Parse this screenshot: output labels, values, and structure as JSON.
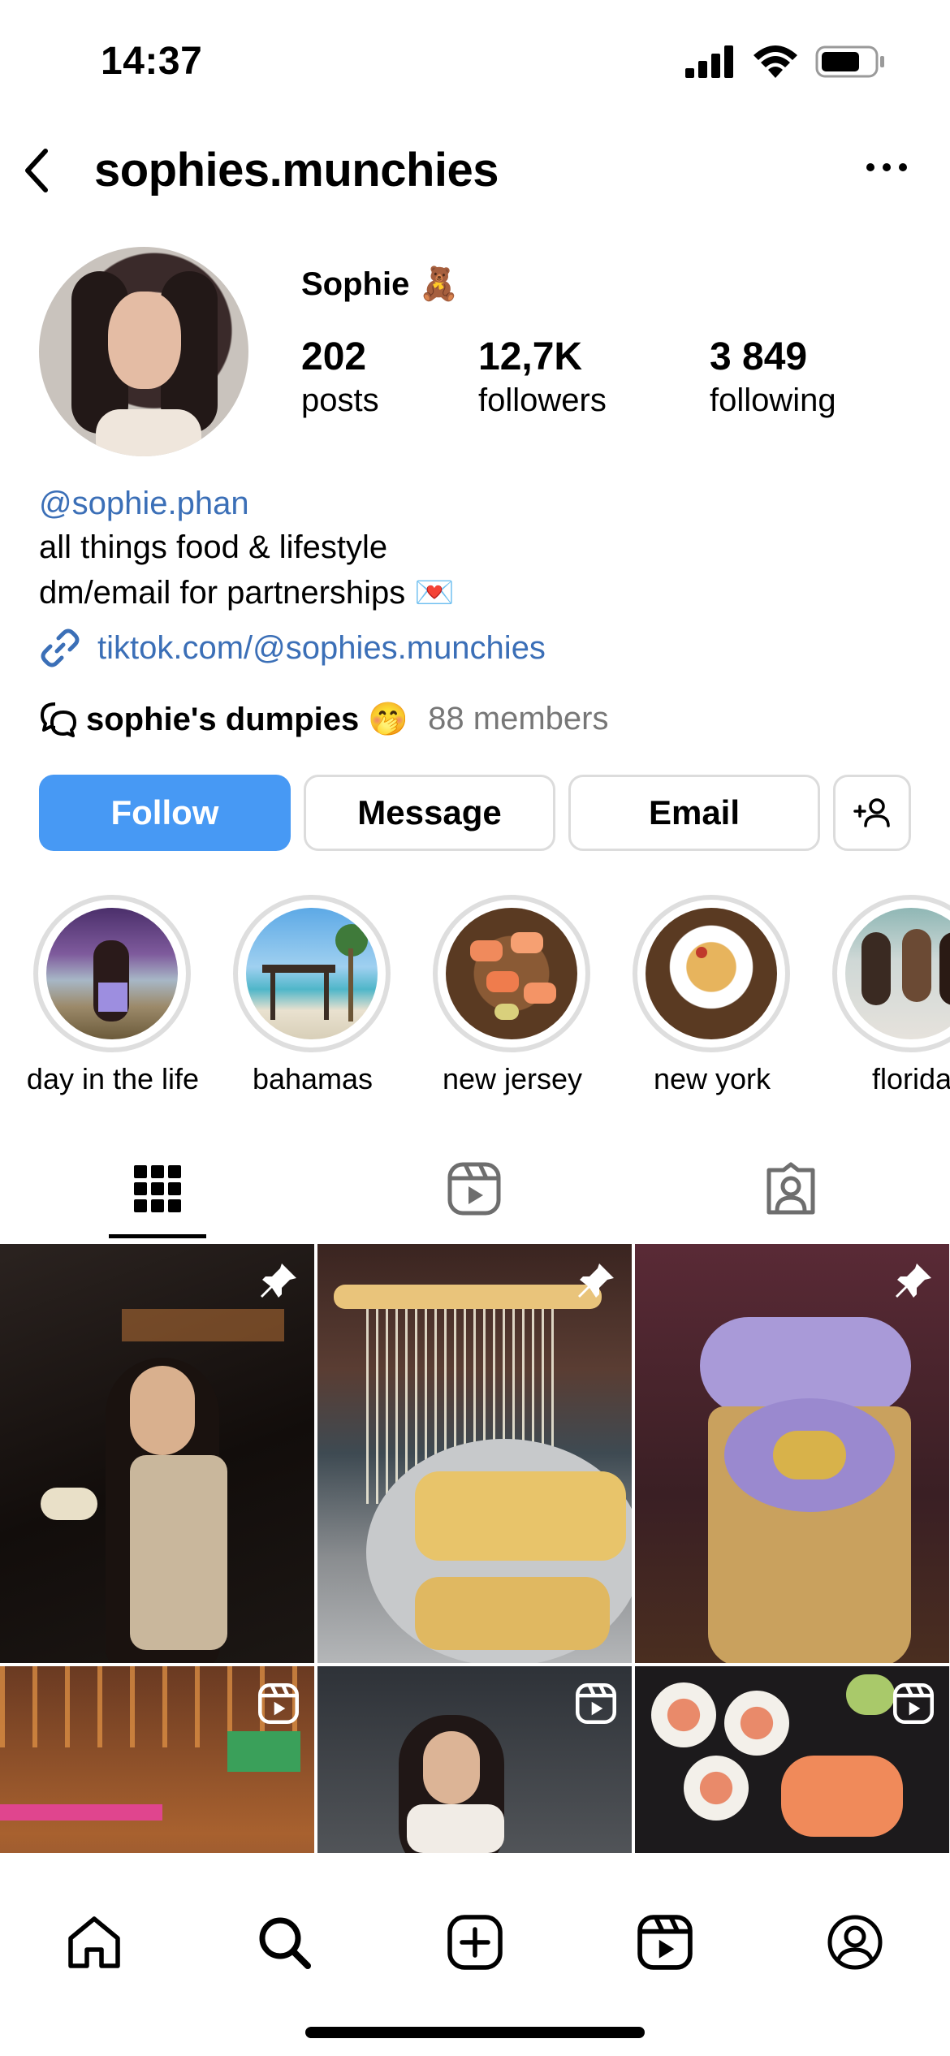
{
  "status_bar": {
    "time": "14:37"
  },
  "header": {
    "username": "sophies.munchies"
  },
  "profile": {
    "display_name": "Sophie 🧸",
    "stats": [
      {
        "value": "202",
        "label": "posts"
      },
      {
        "value": "12,7K",
        "label": "followers"
      },
      {
        "value": "3 849",
        "label": "following"
      }
    ],
    "bio": {
      "handle": "@sophie.phan",
      "lines": [
        "all things food & lifestyle",
        "dm/email for partnerships 💌"
      ],
      "link": "tiktok.com/@sophies.munchies"
    },
    "channel": {
      "name": "sophie's dumpies 🤭",
      "members": "88 members"
    }
  },
  "actions": {
    "follow": "Follow",
    "message": "Message",
    "email": "Email"
  },
  "highlights": [
    {
      "label": "day in the life"
    },
    {
      "label": "bahamas"
    },
    {
      "label": "new jersey"
    },
    {
      "label": "new york"
    },
    {
      "label": "florida"
    }
  ],
  "tabs": [
    "grid-icon",
    "reels-icon",
    "tagged-icon"
  ],
  "grid": [
    {
      "type": "pinned"
    },
    {
      "type": "pinned"
    },
    {
      "type": "pinned"
    },
    {
      "type": "reel"
    },
    {
      "type": "reel"
    },
    {
      "type": "reel"
    }
  ],
  "colors": {
    "accent": "#4799f4",
    "link": "#3b6fb7",
    "muted": "#777777"
  }
}
